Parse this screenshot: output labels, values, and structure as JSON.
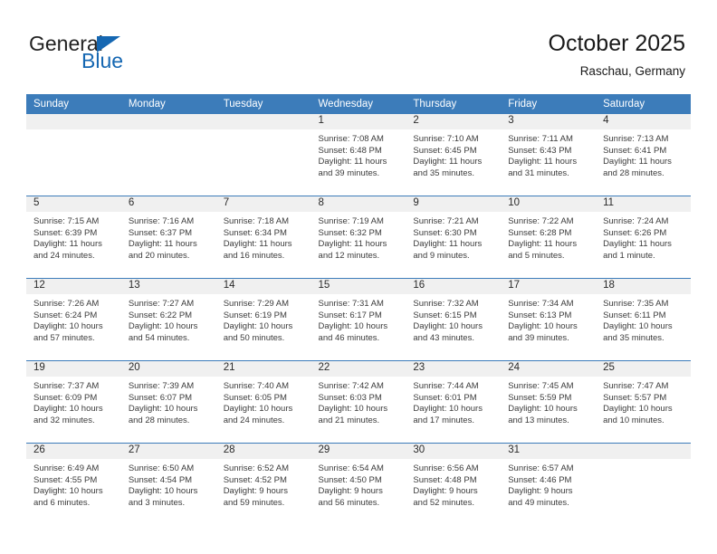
{
  "brand": {
    "name_part1": "General",
    "name_part2": "Blue",
    "accent_color": "#1567b2",
    "triangle_icon": "triangle-logo-icon"
  },
  "header": {
    "title": "October 2025",
    "subtitle": "Raschau, Germany"
  },
  "theme": {
    "header_row_bg": "#3c7cba",
    "day_number_band_bg": "#f0f0f0",
    "cell_text_color": "#3b3b3b",
    "page_bg": "#ffffff"
  },
  "calendar": {
    "weekday_headers": [
      "Sunday",
      "Monday",
      "Tuesday",
      "Wednesday",
      "Thursday",
      "Friday",
      "Saturday"
    ],
    "labels": {
      "sunrise": "Sunrise:",
      "sunset": "Sunset:",
      "daylight": "Daylight:"
    },
    "weeks": [
      [
        {
          "day": "",
          "empty": true
        },
        {
          "day": "",
          "empty": true
        },
        {
          "day": "",
          "empty": true
        },
        {
          "day": "1",
          "sunrise": "Sunrise: 7:08 AM",
          "sunset": "Sunset: 6:48 PM",
          "daylight_1": "Daylight: 11 hours",
          "daylight_2": "and 39 minutes."
        },
        {
          "day": "2",
          "sunrise": "Sunrise: 7:10 AM",
          "sunset": "Sunset: 6:45 PM",
          "daylight_1": "Daylight: 11 hours",
          "daylight_2": "and 35 minutes."
        },
        {
          "day": "3",
          "sunrise": "Sunrise: 7:11 AM",
          "sunset": "Sunset: 6:43 PM",
          "daylight_1": "Daylight: 11 hours",
          "daylight_2": "and 31 minutes."
        },
        {
          "day": "4",
          "sunrise": "Sunrise: 7:13 AM",
          "sunset": "Sunset: 6:41 PM",
          "daylight_1": "Daylight: 11 hours",
          "daylight_2": "and 28 minutes."
        }
      ],
      [
        {
          "day": "5",
          "sunrise": "Sunrise: 7:15 AM",
          "sunset": "Sunset: 6:39 PM",
          "daylight_1": "Daylight: 11 hours",
          "daylight_2": "and 24 minutes."
        },
        {
          "day": "6",
          "sunrise": "Sunrise: 7:16 AM",
          "sunset": "Sunset: 6:37 PM",
          "daylight_1": "Daylight: 11 hours",
          "daylight_2": "and 20 minutes."
        },
        {
          "day": "7",
          "sunrise": "Sunrise: 7:18 AM",
          "sunset": "Sunset: 6:34 PM",
          "daylight_1": "Daylight: 11 hours",
          "daylight_2": "and 16 minutes."
        },
        {
          "day": "8",
          "sunrise": "Sunrise: 7:19 AM",
          "sunset": "Sunset: 6:32 PM",
          "daylight_1": "Daylight: 11 hours",
          "daylight_2": "and 12 minutes."
        },
        {
          "day": "9",
          "sunrise": "Sunrise: 7:21 AM",
          "sunset": "Sunset: 6:30 PM",
          "daylight_1": "Daylight: 11 hours",
          "daylight_2": "and 9 minutes."
        },
        {
          "day": "10",
          "sunrise": "Sunrise: 7:22 AM",
          "sunset": "Sunset: 6:28 PM",
          "daylight_1": "Daylight: 11 hours",
          "daylight_2": "and 5 minutes."
        },
        {
          "day": "11",
          "sunrise": "Sunrise: 7:24 AM",
          "sunset": "Sunset: 6:26 PM",
          "daylight_1": "Daylight: 11 hours",
          "daylight_2": "and 1 minute."
        }
      ],
      [
        {
          "day": "12",
          "sunrise": "Sunrise: 7:26 AM",
          "sunset": "Sunset: 6:24 PM",
          "daylight_1": "Daylight: 10 hours",
          "daylight_2": "and 57 minutes."
        },
        {
          "day": "13",
          "sunrise": "Sunrise: 7:27 AM",
          "sunset": "Sunset: 6:22 PM",
          "daylight_1": "Daylight: 10 hours",
          "daylight_2": "and 54 minutes."
        },
        {
          "day": "14",
          "sunrise": "Sunrise: 7:29 AM",
          "sunset": "Sunset: 6:19 PM",
          "daylight_1": "Daylight: 10 hours",
          "daylight_2": "and 50 minutes."
        },
        {
          "day": "15",
          "sunrise": "Sunrise: 7:31 AM",
          "sunset": "Sunset: 6:17 PM",
          "daylight_1": "Daylight: 10 hours",
          "daylight_2": "and 46 minutes."
        },
        {
          "day": "16",
          "sunrise": "Sunrise: 7:32 AM",
          "sunset": "Sunset: 6:15 PM",
          "daylight_1": "Daylight: 10 hours",
          "daylight_2": "and 43 minutes."
        },
        {
          "day": "17",
          "sunrise": "Sunrise: 7:34 AM",
          "sunset": "Sunset: 6:13 PM",
          "daylight_1": "Daylight: 10 hours",
          "daylight_2": "and 39 minutes."
        },
        {
          "day": "18",
          "sunrise": "Sunrise: 7:35 AM",
          "sunset": "Sunset: 6:11 PM",
          "daylight_1": "Daylight: 10 hours",
          "daylight_2": "and 35 minutes."
        }
      ],
      [
        {
          "day": "19",
          "sunrise": "Sunrise: 7:37 AM",
          "sunset": "Sunset: 6:09 PM",
          "daylight_1": "Daylight: 10 hours",
          "daylight_2": "and 32 minutes."
        },
        {
          "day": "20",
          "sunrise": "Sunrise: 7:39 AM",
          "sunset": "Sunset: 6:07 PM",
          "daylight_1": "Daylight: 10 hours",
          "daylight_2": "and 28 minutes."
        },
        {
          "day": "21",
          "sunrise": "Sunrise: 7:40 AM",
          "sunset": "Sunset: 6:05 PM",
          "daylight_1": "Daylight: 10 hours",
          "daylight_2": "and 24 minutes."
        },
        {
          "day": "22",
          "sunrise": "Sunrise: 7:42 AM",
          "sunset": "Sunset: 6:03 PM",
          "daylight_1": "Daylight: 10 hours",
          "daylight_2": "and 21 minutes."
        },
        {
          "day": "23",
          "sunrise": "Sunrise: 7:44 AM",
          "sunset": "Sunset: 6:01 PM",
          "daylight_1": "Daylight: 10 hours",
          "daylight_2": "and 17 minutes."
        },
        {
          "day": "24",
          "sunrise": "Sunrise: 7:45 AM",
          "sunset": "Sunset: 5:59 PM",
          "daylight_1": "Daylight: 10 hours",
          "daylight_2": "and 13 minutes."
        },
        {
          "day": "25",
          "sunrise": "Sunrise: 7:47 AM",
          "sunset": "Sunset: 5:57 PM",
          "daylight_1": "Daylight: 10 hours",
          "daylight_2": "and 10 minutes."
        }
      ],
      [
        {
          "day": "26",
          "sunrise": "Sunrise: 6:49 AM",
          "sunset": "Sunset: 4:55 PM",
          "daylight_1": "Daylight: 10 hours",
          "daylight_2": "and 6 minutes."
        },
        {
          "day": "27",
          "sunrise": "Sunrise: 6:50 AM",
          "sunset": "Sunset: 4:54 PM",
          "daylight_1": "Daylight: 10 hours",
          "daylight_2": "and 3 minutes."
        },
        {
          "day": "28",
          "sunrise": "Sunrise: 6:52 AM",
          "sunset": "Sunset: 4:52 PM",
          "daylight_1": "Daylight: 9 hours",
          "daylight_2": "and 59 minutes."
        },
        {
          "day": "29",
          "sunrise": "Sunrise: 6:54 AM",
          "sunset": "Sunset: 4:50 PM",
          "daylight_1": "Daylight: 9 hours",
          "daylight_2": "and 56 minutes."
        },
        {
          "day": "30",
          "sunrise": "Sunrise: 6:56 AM",
          "sunset": "Sunset: 4:48 PM",
          "daylight_1": "Daylight: 9 hours",
          "daylight_2": "and 52 minutes."
        },
        {
          "day": "31",
          "sunrise": "Sunrise: 6:57 AM",
          "sunset": "Sunset: 4:46 PM",
          "daylight_1": "Daylight: 9 hours",
          "daylight_2": "and 49 minutes."
        },
        {
          "day": "",
          "empty": true
        }
      ]
    ]
  }
}
